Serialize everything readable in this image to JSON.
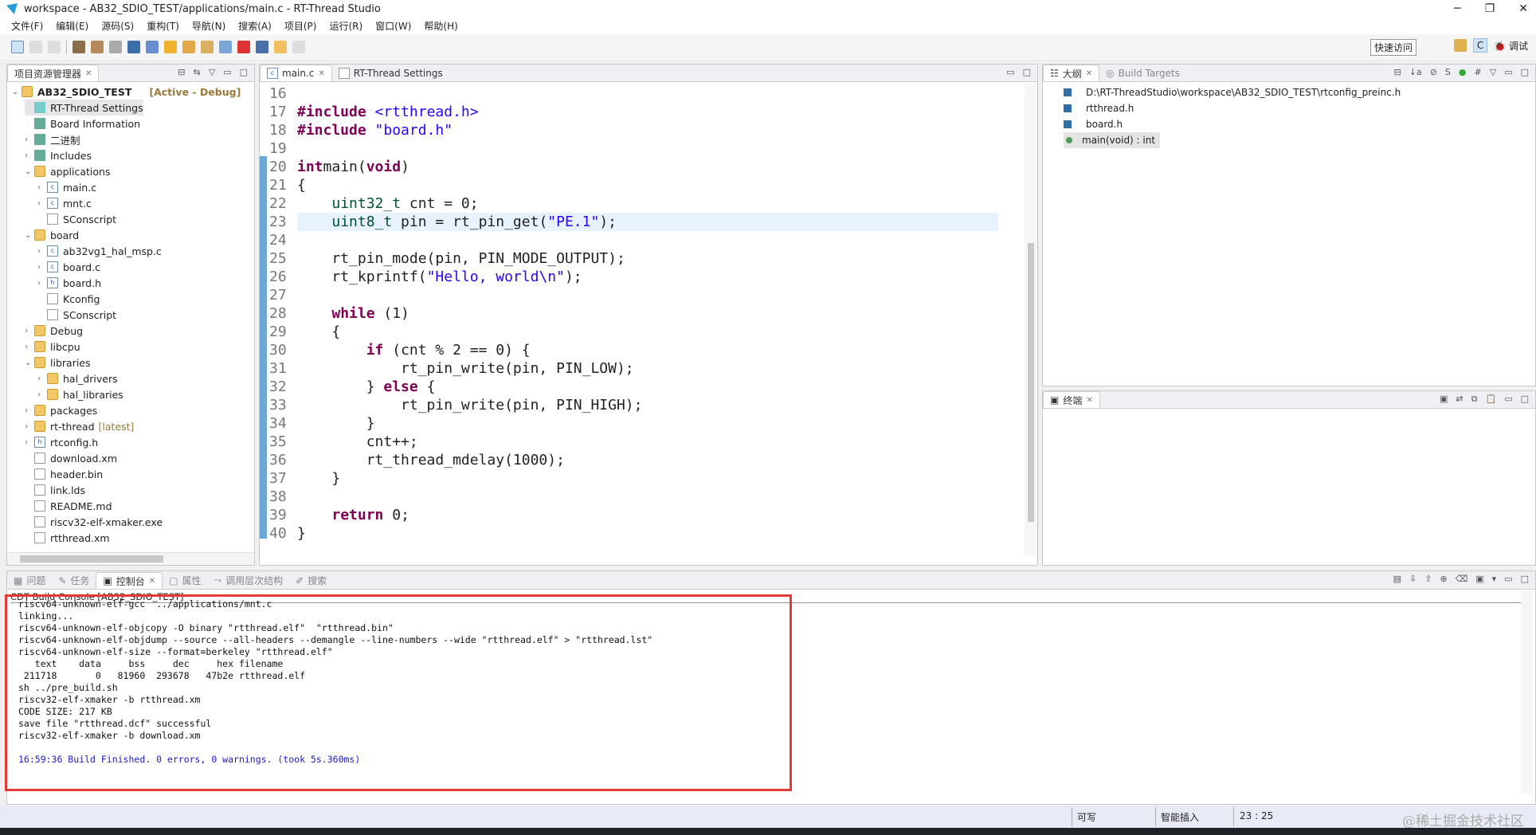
{
  "window": {
    "title": "workspace - AB32_SDIO_TEST/applications/main.c - RT-Thread Studio",
    "controls": [
      "─",
      "❐",
      "✕"
    ]
  },
  "menu": [
    "文件(F)",
    "编辑(E)",
    "源码(S)",
    "重构(T)",
    "导航(N)",
    "搜索(A)",
    "项目(P)",
    "运行(R)",
    "窗口(W)",
    "帮助(H)"
  ],
  "toolbar": {
    "quick_access": "快速访问",
    "perspective_c": "C",
    "perspective_debug": "调试"
  },
  "explorer": {
    "tab": "项目资源管理器",
    "project": "AB32_SDIO_TEST",
    "project_status": "[Active - Debug]",
    "items": [
      {
        "label": "RT-Thread Settings",
        "depth": 1,
        "icon": "rt-icon",
        "tw": ""
      },
      {
        "label": "Board Information",
        "depth": 1,
        "icon": "board-icon",
        "tw": ""
      },
      {
        "label": "二进制",
        "depth": 1,
        "icon": "binary-icon",
        "tw": "›"
      },
      {
        "label": "Includes",
        "depth": 1,
        "icon": "includes-icon",
        "tw": "›"
      },
      {
        "label": "applications",
        "depth": 1,
        "icon": "folder-icon",
        "tw": "⌄"
      },
      {
        "label": "main.c",
        "depth": 2,
        "icon": "c-file-icon",
        "tw": "›"
      },
      {
        "label": "mnt.c",
        "depth": 2,
        "icon": "c-file-icon",
        "tw": "›"
      },
      {
        "label": "SConscript",
        "depth": 2,
        "icon": "file-icon",
        "tw": ""
      },
      {
        "label": "board",
        "depth": 1,
        "icon": "folder-icon",
        "tw": "⌄"
      },
      {
        "label": "ab32vg1_hal_msp.c",
        "depth": 2,
        "icon": "c-file-icon",
        "tw": "›"
      },
      {
        "label": "board.c",
        "depth": 2,
        "icon": "c-file-icon",
        "tw": "›"
      },
      {
        "label": "board.h",
        "depth": 2,
        "icon": "h-file-icon",
        "tw": "›"
      },
      {
        "label": "Kconfig",
        "depth": 2,
        "icon": "file-icon",
        "tw": ""
      },
      {
        "label": "SConscript",
        "depth": 2,
        "icon": "file-icon",
        "tw": ""
      },
      {
        "label": "Debug",
        "depth": 1,
        "icon": "folder-icon",
        "tw": "›"
      },
      {
        "label": "libcpu",
        "depth": 1,
        "icon": "folder-icon",
        "tw": "›"
      },
      {
        "label": "libraries",
        "depth": 1,
        "icon": "folder-icon",
        "tw": "⌄"
      },
      {
        "label": "hal_drivers",
        "depth": 2,
        "icon": "folder-icon",
        "tw": "›"
      },
      {
        "label": "hal_libraries",
        "depth": 2,
        "icon": "folder-icon",
        "tw": "›"
      },
      {
        "label": "packages",
        "depth": 1,
        "icon": "folder-icon",
        "tw": "›"
      },
      {
        "label": "rt-thread",
        "depth": 1,
        "icon": "folder-icon",
        "tw": "›",
        "suffix": "[latest]"
      },
      {
        "label": "rtconfig.h",
        "depth": 1,
        "icon": "h-file-icon",
        "tw": "›"
      },
      {
        "label": "download.xm",
        "depth": 1,
        "icon": "file-icon",
        "tw": ""
      },
      {
        "label": "header.bin",
        "depth": 1,
        "icon": "file-icon",
        "tw": ""
      },
      {
        "label": "link.lds",
        "depth": 1,
        "icon": "file-icon",
        "tw": ""
      },
      {
        "label": "README.md",
        "depth": 1,
        "icon": "file-icon",
        "tw": ""
      },
      {
        "label": "riscv32-elf-xmaker.exe",
        "depth": 1,
        "icon": "file-icon",
        "tw": ""
      },
      {
        "label": "rtthread.xm",
        "depth": 1,
        "icon": "file-icon",
        "tw": ""
      }
    ]
  },
  "editor": {
    "tabs": [
      "main.c",
      "RT-Thread Settings"
    ],
    "current_line": 23,
    "lines": [
      {
        "n": "16",
        "t": []
      },
      {
        "n": "17",
        "t": [
          [
            "kw",
            "#include "
          ],
          [
            "str",
            "<rtthread.h>"
          ]
        ]
      },
      {
        "n": "18",
        "t": [
          [
            "kw",
            "#include "
          ],
          [
            "str",
            "\"board.h\""
          ]
        ]
      },
      {
        "n": "19",
        "t": []
      },
      {
        "n": "20",
        "t": [
          [
            "kw",
            "int"
          ],
          [
            "",
            "main("
          ],
          [
            "kw",
            "void"
          ],
          [
            "",
            ")"
          ]
        ]
      },
      {
        "n": "21",
        "t": [
          [
            "",
            "{"
          ]
        ]
      },
      {
        "n": "22",
        "t": [
          [
            "",
            "    "
          ],
          [
            "typ",
            "uint32_t"
          ],
          [
            "",
            " cnt = 0;"
          ]
        ]
      },
      {
        "n": "23",
        "t": [
          [
            "",
            "    "
          ],
          [
            "typ",
            "uint8_t"
          ],
          [
            "",
            " pin = rt_pin_get("
          ],
          [
            "str",
            "\"PE.1\""
          ],
          [
            "",
            ");"
          ]
        ]
      },
      {
        "n": "24",
        "t": []
      },
      {
        "n": "25",
        "t": [
          [
            "",
            "    rt_pin_mode(pin, PIN_MODE_OUTPUT);"
          ]
        ]
      },
      {
        "n": "26",
        "t": [
          [
            "",
            "    rt_kprintf("
          ],
          [
            "str",
            "\"Hello, world\\n\""
          ],
          [
            "",
            ");"
          ]
        ]
      },
      {
        "n": "27",
        "t": []
      },
      {
        "n": "28",
        "t": [
          [
            "",
            "    "
          ],
          [
            "kw",
            "while"
          ],
          [
            "",
            "",
            " (1)"
          ]
        ]
      },
      {
        "n": "29",
        "t": [
          [
            "",
            "    {"
          ]
        ]
      },
      {
        "n": "30",
        "t": [
          [
            "",
            "        "
          ],
          [
            "kw",
            "if"
          ],
          [
            "",
            "",
            " (cnt % 2 == 0) {"
          ]
        ]
      },
      {
        "n": "31",
        "t": [
          [
            "",
            "            rt_pin_write(pin, PIN_LOW);"
          ]
        ]
      },
      {
        "n": "32",
        "t": [
          [
            "",
            "        } "
          ],
          [
            "kw",
            "else"
          ],
          [
            "",
            "",
            " {"
          ]
        ]
      },
      {
        "n": "33",
        "t": [
          [
            "",
            "            rt_pin_write(pin, PIN_HIGH);"
          ]
        ]
      },
      {
        "n": "34",
        "t": [
          [
            "",
            "        }"
          ]
        ]
      },
      {
        "n": "35",
        "t": [
          [
            "",
            "        cnt++;"
          ]
        ]
      },
      {
        "n": "36",
        "t": [
          [
            "",
            "        rt_thread_mdelay(1000);"
          ]
        ]
      },
      {
        "n": "37",
        "t": [
          [
            "",
            "    }"
          ]
        ]
      },
      {
        "n": "38",
        "t": []
      },
      {
        "n": "39",
        "t": [
          [
            "",
            "    "
          ],
          [
            "kw",
            "return"
          ],
          [
            "",
            "",
            " 0;"
          ]
        ]
      },
      {
        "n": "40",
        "t": [
          [
            "",
            "}"
          ]
        ]
      }
    ]
  },
  "outline": {
    "tabs": [
      "大纲",
      "Build Targets"
    ],
    "items": [
      {
        "label": "D:\\RT-ThreadStudio\\workspace\\AB32_SDIO_TEST\\rtconfig_preinc.h",
        "icon": "include-icon"
      },
      {
        "label": "rtthread.h",
        "icon": "include-icon"
      },
      {
        "label": "board.h",
        "icon": "include-icon"
      },
      {
        "label": "main(void) : int",
        "icon": "function-icon"
      }
    ]
  },
  "terminal": {
    "tab": "终端"
  },
  "bottom": {
    "tabs": [
      "问题",
      "任务",
      "控制台",
      "属性",
      "调用层次结构",
      "搜索"
    ],
    "active_tab": 2,
    "console_title": "CDT Build Console [AB32_SDIO_TEST]",
    "lines": [
      "riscv64-unknown-elf-gcc  ../applications/mnt.c",
      "linking...",
      "riscv64-unknown-elf-objcopy -O binary \"rtthread.elf\"  \"rtthread.bin\"",
      "riscv64-unknown-elf-objdump --source --all-headers --demangle --line-numbers --wide \"rtthread.elf\" > \"rtthread.lst\"",
      "riscv64-unknown-elf-size --format=berkeley \"rtthread.elf\"",
      "   text    data     bss     dec     hex filename",
      " 211718       0   81960  293678   47b2e rtthread.elf",
      "sh ../pre_build.sh",
      "riscv32-elf-xmaker -b rtthread.xm",
      "CODE SIZE: 217 KB",
      "save file \"rtthread.dcf\" successful",
      "riscv32-elf-xmaker -b download.xm",
      "",
      "16:59:36 Build Finished. 0 errors, 0 warnings. (took 5s.360ms)"
    ],
    "highlight_color": "#e53935"
  },
  "status": {
    "writable": "可写",
    "insert_mode": "智能插入",
    "position": "23 : 25",
    "watermark": "@稀土掘金技术社区"
  }
}
